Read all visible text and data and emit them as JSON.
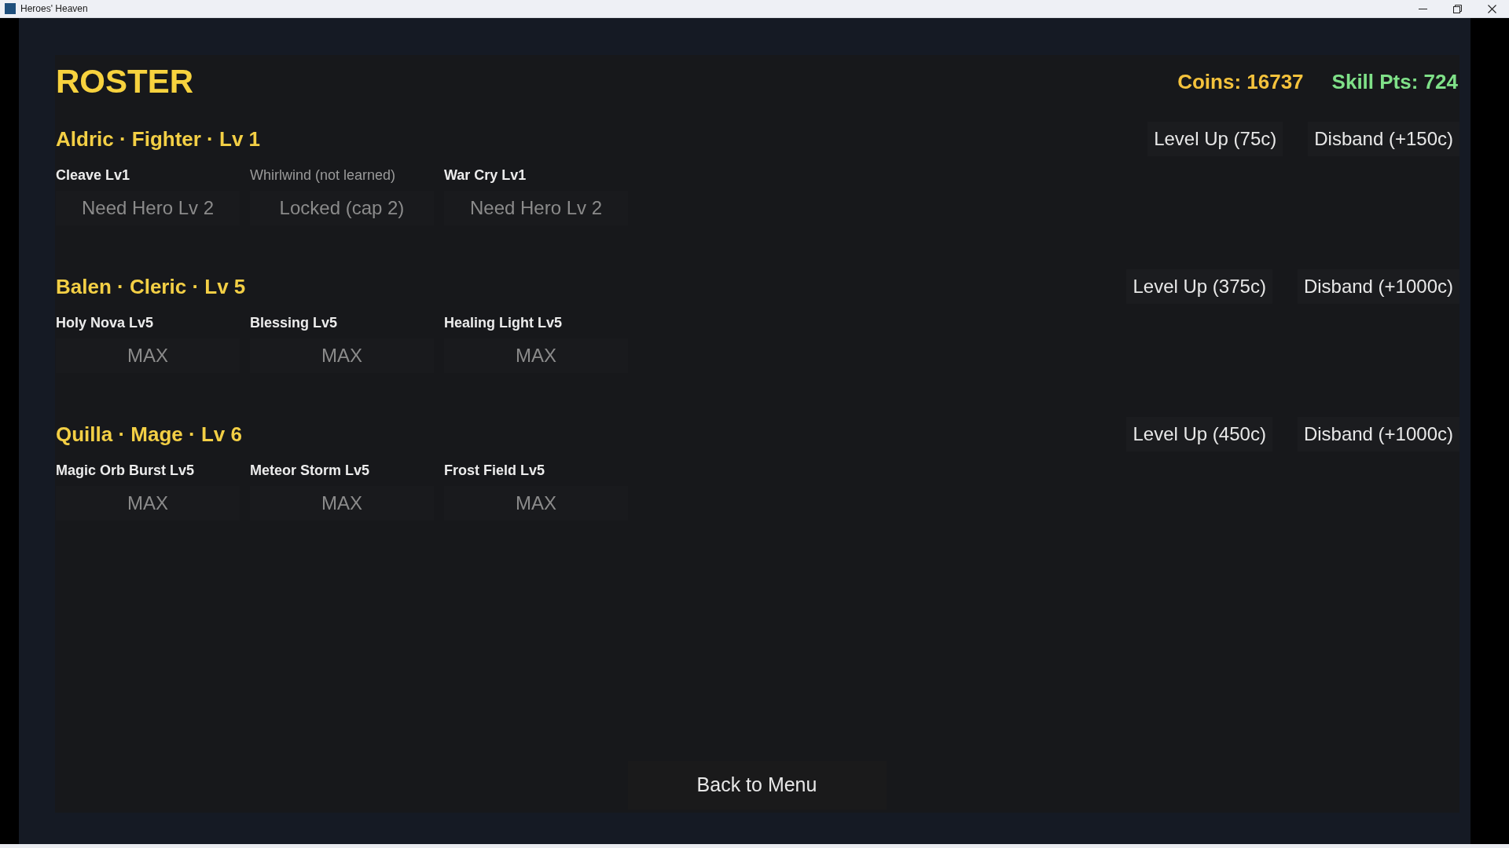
{
  "window": {
    "title": "Heroes' Heaven"
  },
  "screen": {
    "title": "ROSTER",
    "coins": "Coins: 16737",
    "skill_points": "Skill Pts: 724"
  },
  "heroes": [
    {
      "header": "Aldric · Fighter · Lv 1",
      "level_up": "Level Up (75c)",
      "disband": "Disband (+150c)",
      "skills": [
        {
          "name": "Cleave Lv1",
          "learned": true,
          "action": "Need Hero Lv 2",
          "disabled": true
        },
        {
          "name": "Whirlwind (not learned)",
          "learned": false,
          "action": "Locked (cap 2)",
          "disabled": true
        },
        {
          "name": "War Cry Lv1",
          "learned": true,
          "action": "Need Hero Lv 2",
          "disabled": true
        }
      ]
    },
    {
      "header": "Balen · Cleric · Lv 5",
      "level_up": "Level Up (375c)",
      "disband": "Disband (+1000c)",
      "skills": [
        {
          "name": "Holy Nova Lv5",
          "learned": true,
          "action": "MAX",
          "disabled": true
        },
        {
          "name": "Blessing Lv5",
          "learned": true,
          "action": "MAX",
          "disabled": true
        },
        {
          "name": "Healing Light Lv5",
          "learned": true,
          "action": "MAX",
          "disabled": true
        }
      ]
    },
    {
      "header": "Quilla · Mage · Lv 6",
      "level_up": "Level Up (450c)",
      "disband": "Disband (+1000c)",
      "skills": [
        {
          "name": "Magic Orb Burst Lv5",
          "learned": true,
          "action": "MAX",
          "disabled": true
        },
        {
          "name": "Meteor Storm Lv5",
          "learned": true,
          "action": "MAX",
          "disabled": true
        },
        {
          "name": "Frost Field Lv5",
          "learned": true,
          "action": "MAX",
          "disabled": true
        }
      ]
    }
  ],
  "back_button": "Back to Menu"
}
